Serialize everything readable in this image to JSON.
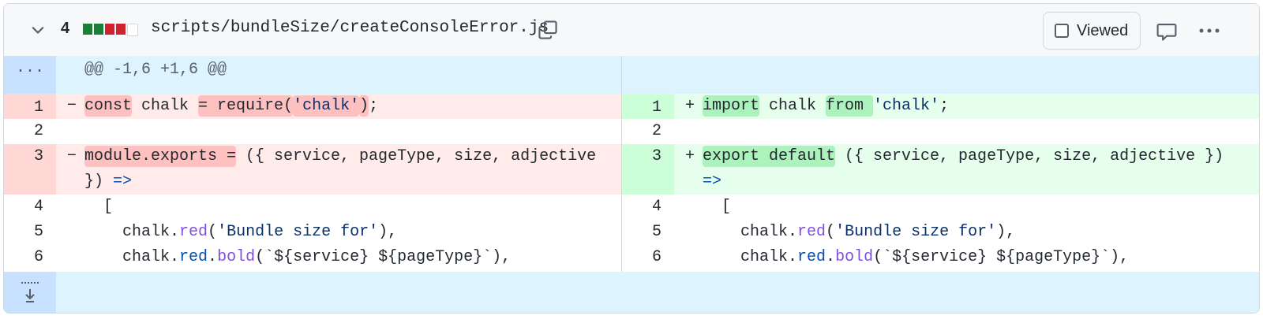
{
  "header": {
    "change_count": "4",
    "diffstat_colors": [
      "#1a7f37",
      "#1a7f37",
      "#cf222e",
      "#cf222e",
      "#ffffff"
    ],
    "file_path": "scripts/bundleSize/createConsoleError.js",
    "viewed_label": "Viewed",
    "icons": [
      "chevron-down-icon",
      "copy-icon",
      "comment-icon",
      "kebab-horizontal-icon"
    ]
  },
  "hunk": {
    "expander_label": "...",
    "header": "@@ -1,6 +1,6 @@"
  },
  "left": {
    "lines": [
      {
        "num": "1",
        "sign": "−",
        "parts": [
          "const",
          " chalk ",
          "= require(",
          "'chalk'",
          ")",
          ";"
        ]
      },
      {
        "num": "2"
      },
      {
        "num": "3",
        "sign": "−",
        "parts": [
          "module.exports =",
          " ({ service, pageType, size, adjective",
          "})",
          " =>"
        ]
      },
      {
        "num": "4",
        "text": "  ["
      },
      {
        "num": "5",
        "parts": [
          "    chalk.",
          "red",
          "(",
          "'Bundle size for'",
          "),"
        ]
      },
      {
        "num": "6",
        "parts": [
          "    chalk.",
          "red",
          ".",
          "bold",
          "(`${service} ${pageType}`),"
        ]
      }
    ]
  },
  "right": {
    "lines": [
      {
        "num": "1",
        "sign": "+",
        "parts": [
          "import",
          " chalk ",
          "from ",
          "'chalk'",
          ";"
        ]
      },
      {
        "num": "2"
      },
      {
        "num": "3",
        "sign": "+",
        "parts": [
          "export default",
          " ({ service, pageType, size, adjective })",
          "=>"
        ]
      },
      {
        "num": "4",
        "text": "  ["
      },
      {
        "num": "5",
        "parts": [
          "    chalk.",
          "red",
          "(",
          "'Bundle size for'",
          "),"
        ]
      },
      {
        "num": "6",
        "parts": [
          "    chalk.",
          "red",
          ".",
          "bold",
          "(`${service} ${pageType}`),"
        ]
      }
    ]
  }
}
